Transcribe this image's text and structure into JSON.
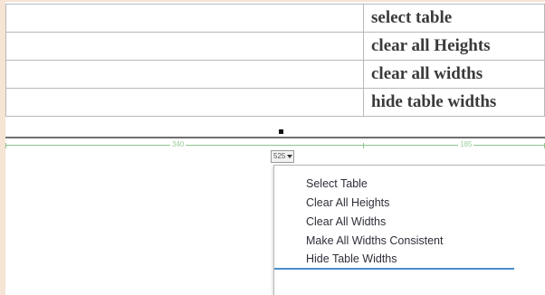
{
  "table": {
    "rows": [
      {
        "right_cell": "select table"
      },
      {
        "right_cell": "clear all Heights"
      },
      {
        "right_cell": "clear all widths"
      },
      {
        "right_cell": "hide table widths"
      }
    ]
  },
  "widths_visual_aid": {
    "left_column_label": "340",
    "right_column_label": "185",
    "header_button_label": "525"
  },
  "context_menu": {
    "items": [
      {
        "label": "Select Table"
      },
      {
        "label": "Clear All Heights"
      },
      {
        "label": "Clear All Widths"
      },
      {
        "label": "Make All Widths Consistent"
      },
      {
        "label": "Hide Table Widths"
      }
    ]
  },
  "colors": {
    "page_background": "#f6e4d4",
    "visual_aid_green": "#8dc58d",
    "menu_highlight_underline": "#4a8fc9"
  }
}
